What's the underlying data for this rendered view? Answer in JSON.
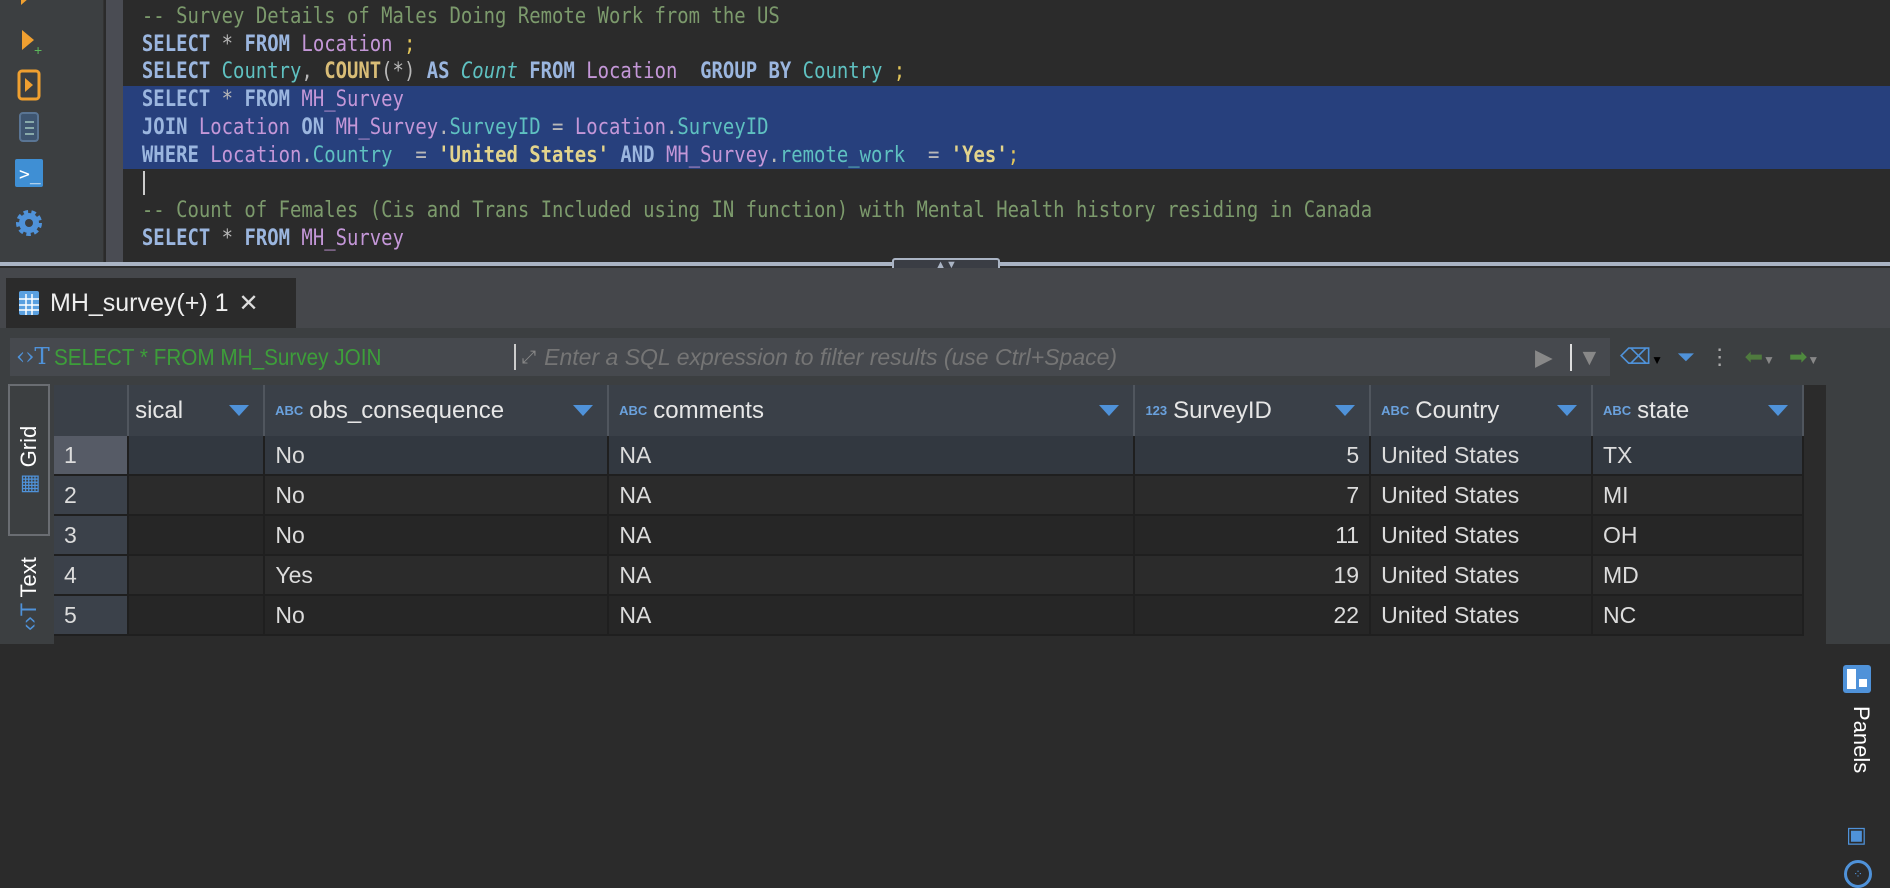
{
  "toolbar": {
    "icons": [
      "execute-statement-icon",
      "execute-new-tab-icon",
      "execute-script-icon",
      "explain-plan-icon",
      "terminal-icon",
      "settings-icon"
    ]
  },
  "editor": {
    "lines": [
      [
        [
          "-- Survey Details of Males Doing Remote Work from the US",
          "cm"
        ]
      ],
      [
        [
          "SELECT",
          "kw"
        ],
        [
          " * ",
          "op"
        ],
        [
          "FROM",
          "kw"
        ],
        [
          " ",
          ""
        ],
        [
          "Location",
          "tbl"
        ],
        [
          " ;",
          "sc"
        ]
      ],
      [
        [
          "SELECT",
          "kw"
        ],
        [
          " ",
          ""
        ],
        [
          "Country",
          "col"
        ],
        [
          ", ",
          "op"
        ],
        [
          "COUNT",
          "fn"
        ],
        [
          "(*) ",
          "op"
        ],
        [
          "AS",
          "kw"
        ],
        [
          " ",
          ""
        ],
        [
          "Count",
          "it"
        ],
        [
          " ",
          ""
        ],
        [
          "FROM",
          "kw"
        ],
        [
          " ",
          ""
        ],
        [
          "Location",
          "tbl"
        ],
        [
          "  ",
          ""
        ],
        [
          "GROUP BY",
          "kw"
        ],
        [
          " ",
          ""
        ],
        [
          "Country",
          "col"
        ],
        [
          " ;",
          "sc"
        ]
      ],
      [
        [
          "SELECT",
          "kw"
        ],
        [
          " * ",
          "op"
        ],
        [
          "FROM",
          "kw"
        ],
        [
          " ",
          ""
        ],
        [
          "MH_Survey",
          "tbl"
        ]
      ],
      [
        [
          "JOIN",
          "kw"
        ],
        [
          " ",
          ""
        ],
        [
          "Location",
          "tbl"
        ],
        [
          " ",
          ""
        ],
        [
          "ON",
          "kw"
        ],
        [
          " ",
          ""
        ],
        [
          "MH_Survey",
          "tbl"
        ],
        [
          ".",
          "op"
        ],
        [
          "SurveyID",
          "col"
        ],
        [
          " = ",
          "op"
        ],
        [
          "Location",
          "tbl"
        ],
        [
          ".",
          "op"
        ],
        [
          "SurveyID",
          "col"
        ]
      ],
      [
        [
          "WHERE",
          "kw"
        ],
        [
          " ",
          ""
        ],
        [
          "Location",
          "tbl"
        ],
        [
          ".",
          "op"
        ],
        [
          "Country",
          "col"
        ],
        [
          "  = ",
          "op"
        ],
        [
          "'United States'",
          "str"
        ],
        [
          " ",
          ""
        ],
        [
          "AND",
          "kw"
        ],
        [
          " ",
          ""
        ],
        [
          "MH_Survey",
          "tbl"
        ],
        [
          ".",
          "op"
        ],
        [
          "remote_work",
          "col"
        ],
        [
          "  = ",
          "op"
        ],
        [
          "'Yes'",
          "str"
        ],
        [
          ";",
          "sc"
        ]
      ],
      [],
      [
        [
          "-- Count of Females (Cis and Trans Included using IN function) with Mental Health history residing in Canada",
          "cm"
        ]
      ],
      [
        [
          "SELECT",
          "kw"
        ],
        [
          " * ",
          "op"
        ],
        [
          "FROM",
          "kw"
        ],
        [
          " ",
          ""
        ],
        [
          "MH_Survey",
          "tbl"
        ]
      ]
    ]
  },
  "results": {
    "tab_label": "MH_survey(+) 1",
    "filter_query": "SELECT * FROM MH_Survey JOIN",
    "filter_placeholder": "Enter a SQL expression to filter results (use Ctrl+Space)",
    "view_tabs": [
      "Grid",
      "Text"
    ],
    "right_panel_label": "Panels",
    "columns": [
      {
        "type": "",
        "name": "sical"
      },
      {
        "type": "ABC",
        "name": "obs_consequence"
      },
      {
        "type": "ABC",
        "name": "comments"
      },
      {
        "type": "123",
        "name": "SurveyID"
      },
      {
        "type": "ABC",
        "name": "Country"
      },
      {
        "type": "ABC",
        "name": "state"
      }
    ],
    "rows": [
      [
        "1",
        "",
        "No",
        "NA",
        "5",
        "United States",
        "TX"
      ],
      [
        "2",
        "",
        "No",
        "NA",
        "7",
        "United States",
        "MI"
      ],
      [
        "3",
        "",
        "No",
        "NA",
        "11",
        "United States",
        "OH"
      ],
      [
        "4",
        "",
        "Yes",
        "NA",
        "19",
        "United States",
        "MD"
      ],
      [
        "5",
        "",
        "No",
        "NA",
        "22",
        "United States",
        "NC"
      ]
    ]
  },
  "colors": {
    "selection": "#27407d",
    "keyword": "#9bb6df",
    "accent": "#4f92d9",
    "filter_text": "#3d9e3a"
  }
}
